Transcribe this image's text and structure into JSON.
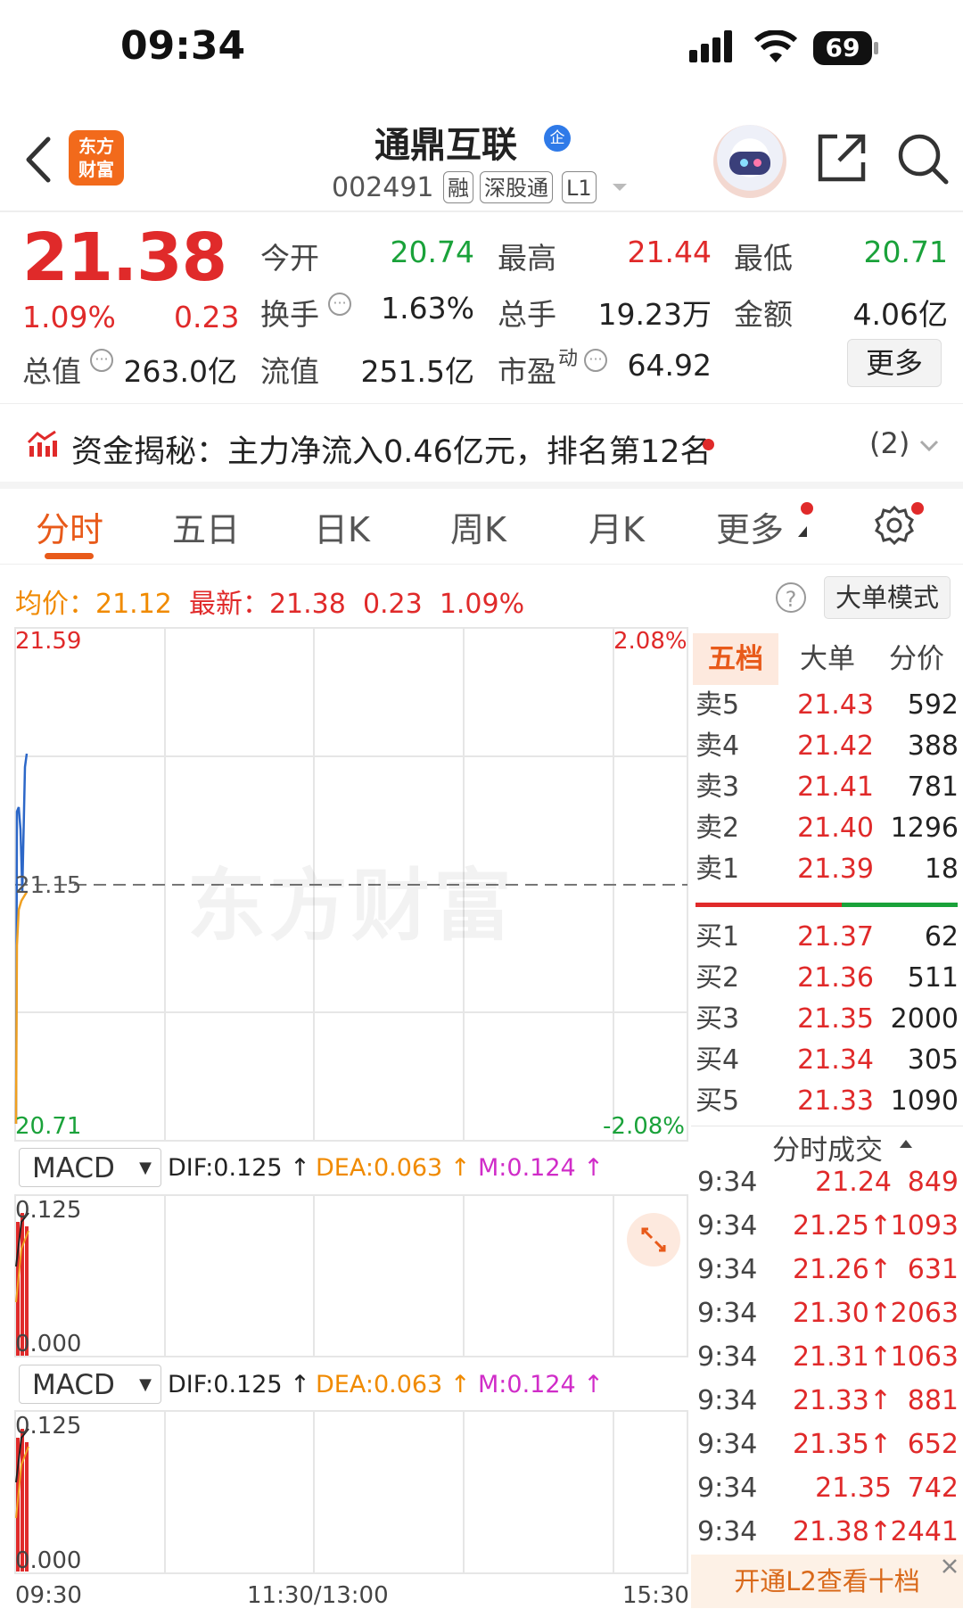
{
  "status": {
    "time": "09:34",
    "battery": "69"
  },
  "header": {
    "logo": "东方\n财富",
    "name": "通鼎互联",
    "verified_badge": "企",
    "code": "002491",
    "tags": [
      "融",
      "深股通",
      "L1"
    ]
  },
  "quote": {
    "price": "21.38",
    "change_pct": "1.09%",
    "change": "0.23",
    "items": [
      {
        "label": "今开",
        "value": "20.74",
        "color": "#1aa23a"
      },
      {
        "label": "最高",
        "value": "21.44",
        "color": "#e02a2a"
      },
      {
        "label": "最低",
        "value": "20.71",
        "color": "#1aa23a"
      },
      {
        "label": "换手",
        "value": "1.63%",
        "color": "#222222"
      },
      {
        "label": "总手",
        "value": "19.23万",
        "color": "#222222"
      },
      {
        "label": "金额",
        "value": "4.06亿",
        "color": "#222222"
      },
      {
        "label": "总值",
        "value": "263.0亿",
        "color": "#222222"
      },
      {
        "label": "流值",
        "value": "251.5亿",
        "color": "#222222"
      },
      {
        "label": "市盈",
        "value": "64.92",
        "color": "#222222"
      }
    ],
    "pe_sup": "动",
    "more_label": "更多"
  },
  "fund_banner": {
    "text": "资金揭秘：主力净流入0.46亿元，排名第12名",
    "count": "(2)"
  },
  "tabs": [
    "分时",
    "五日",
    "日K",
    "周K",
    "月K",
    "更多"
  ],
  "avg_line": {
    "avg_label": "均价：",
    "avg": "21.12",
    "latest_label": "最新：",
    "latest": "21.38",
    "change": "0.23",
    "pct": "1.09%"
  },
  "big_order_btn": "大单模式",
  "help_symbol": "?",
  "chart": {
    "y_max": "21.59",
    "y_mid": "21.15",
    "y_min": "20.71",
    "pct_max": "2.08%",
    "pct_min": "-2.08%",
    "watermark": "东方财富",
    "x_labels": [
      "09:30",
      "11:30/13:00",
      "15:30"
    ]
  },
  "macd_panels": [
    {
      "name": "MACD",
      "dif": "DIF:0.125 ↑",
      "dea": "DEA:0.063 ↑",
      "m": "M:0.124 ↑",
      "top": "0.125",
      "bottom": "0.000"
    },
    {
      "name": "MACD",
      "dif": "DIF:0.125 ↑",
      "dea": "DEA:0.063 ↑",
      "m": "M:0.124 ↑",
      "top": "0.125",
      "bottom": "0.000"
    }
  ],
  "orderbook": {
    "tabs": [
      "五档",
      "大单",
      "分价"
    ],
    "asks": [
      {
        "label": "卖5",
        "price": "21.43",
        "vol": "592"
      },
      {
        "label": "卖4",
        "price": "21.42",
        "vol": "388"
      },
      {
        "label": "卖3",
        "price": "21.41",
        "vol": "781"
      },
      {
        "label": "卖2",
        "price": "21.40",
        "vol": "1296"
      },
      {
        "label": "卖1",
        "price": "21.39",
        "vol": "18"
      }
    ],
    "bids": [
      {
        "label": "买1",
        "price": "21.37",
        "vol": "62"
      },
      {
        "label": "买2",
        "price": "21.36",
        "vol": "511"
      },
      {
        "label": "买3",
        "price": "21.35",
        "vol": "2000"
      },
      {
        "label": "买4",
        "price": "21.34",
        "vol": "305"
      },
      {
        "label": "买5",
        "price": "21.33",
        "vol": "1090"
      }
    ]
  },
  "trades": {
    "title": "分时成交",
    "rows": [
      {
        "time": "9:34",
        "price": "21.24",
        "vol": "849"
      },
      {
        "time": "9:34",
        "price": "21.25↑",
        "vol": "1093"
      },
      {
        "time": "9:34",
        "price": "21.26↑",
        "vol": "631"
      },
      {
        "time": "9:34",
        "price": "21.30↑",
        "vol": "2063"
      },
      {
        "time": "9:34",
        "price": "21.31↑",
        "vol": "1063"
      },
      {
        "time": "9:34",
        "price": "21.33↑",
        "vol": "881"
      },
      {
        "time": "9:34",
        "price": "21.35↑",
        "vol": "652"
      },
      {
        "time": "9:34",
        "price": "21.35",
        "vol": "742"
      },
      {
        "time": "9:34",
        "price": "21.38↑",
        "vol": "2441"
      }
    ]
  },
  "l2_banner": "开通L2查看十档"
}
